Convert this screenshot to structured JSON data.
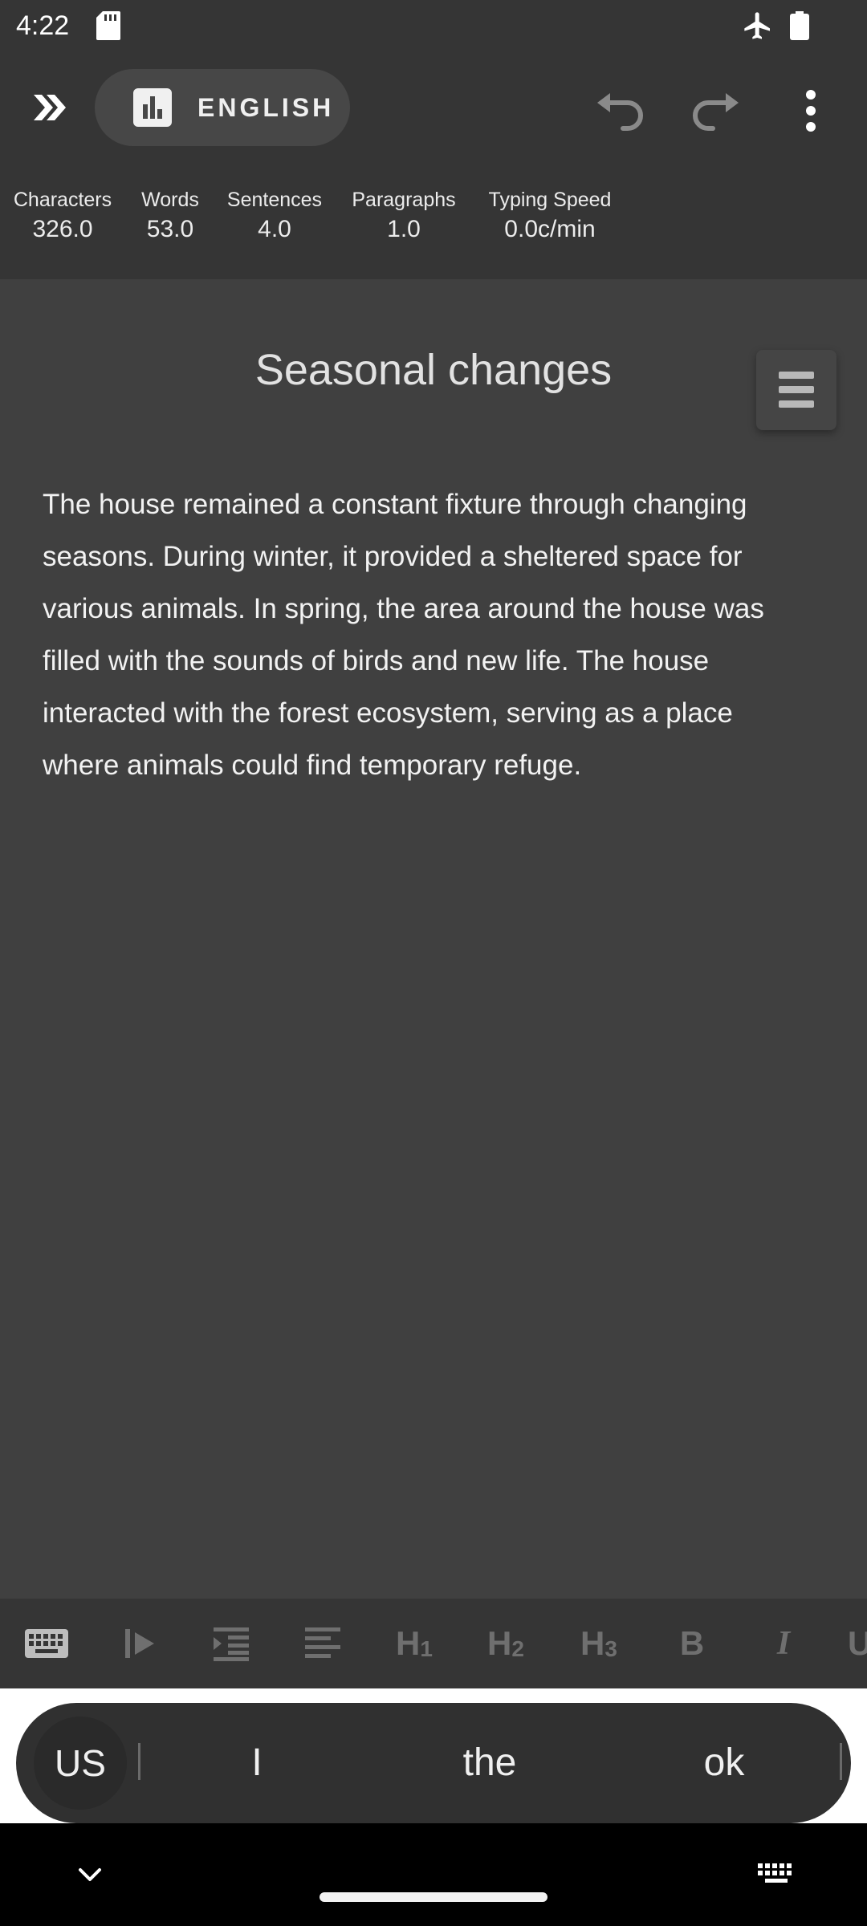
{
  "status_bar": {
    "time": "4:22",
    "icons": [
      "sd-card-icon",
      "airplane-icon",
      "battery-icon"
    ]
  },
  "app_bar": {
    "expand_icon": "double-chevron-right-icon",
    "language_label": "ENGLISH",
    "language_icon": "bar-chart-icon",
    "actions": [
      "undo-icon",
      "redo-icon",
      "more-vert-icon"
    ]
  },
  "stats": [
    {
      "label": "Characters",
      "value": "326.0"
    },
    {
      "label": "Words",
      "value": "53.0"
    },
    {
      "label": "Sentences",
      "value": "4.0"
    },
    {
      "label": "Paragraphs",
      "value": "1.0"
    },
    {
      "label": "Typing Speed",
      "value": "0.0c/min"
    }
  ],
  "document": {
    "title": "Seasonal changes",
    "body": "The house remained a constant fixture through changing seasons. During winter, it provided a sheltered space for various animals. In spring, the area around the house was filled with the sounds of birds and new life. The house interacted with the forest ecosystem, serving as a place where animals could find temporary refuge."
  },
  "format_toolbar": {
    "items": [
      "keyboard-icon",
      "play-icon",
      "indent-icon",
      "align-left-icon",
      "H1",
      "H2",
      "H3",
      "B",
      "I"
    ]
  },
  "suggestions": {
    "language_key": "US",
    "words": [
      "I",
      "the",
      "ok"
    ]
  },
  "nav_bar": {
    "icons": [
      "chevron-down-icon",
      "keyboard-icon"
    ]
  },
  "colors": {
    "background": "#404040",
    "bar": "#353535",
    "icon_muted": "#6f6f6f",
    "text": "#f2f2f2"
  }
}
